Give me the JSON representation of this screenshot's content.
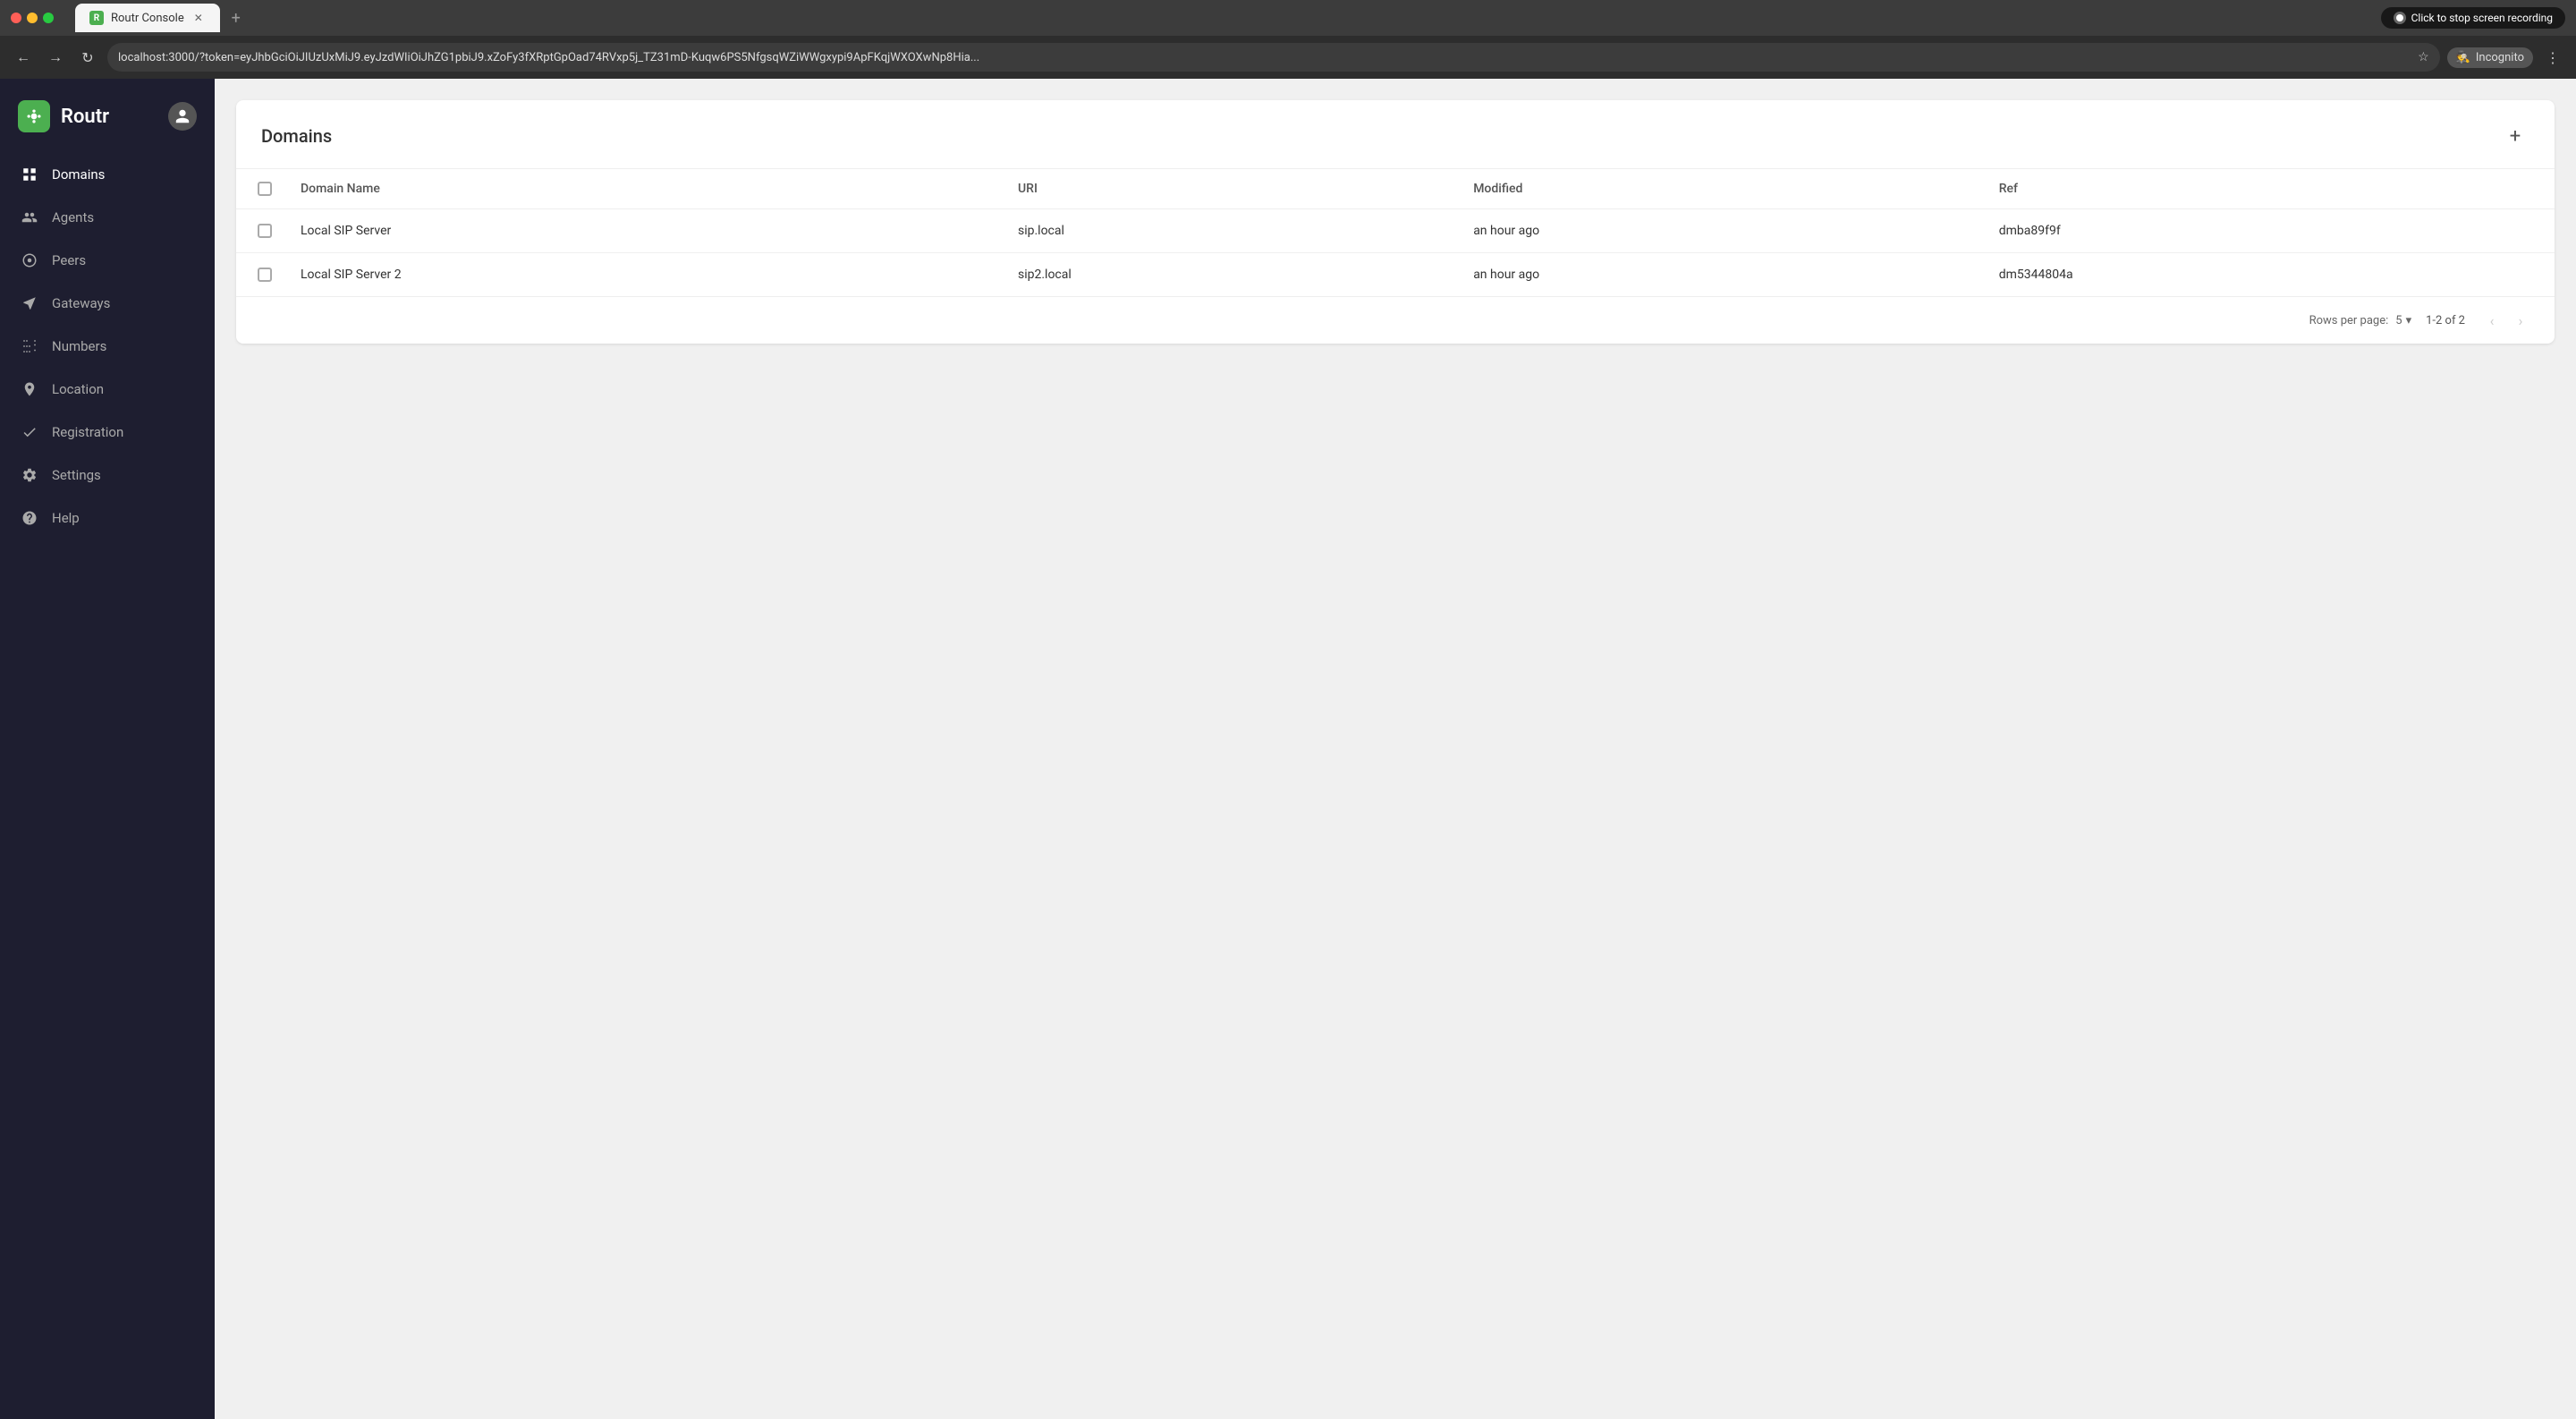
{
  "browser": {
    "tab_title": "Routr Console",
    "url": "localhost:3000/?token=eyJhbGciOiJIUzUxMiJ9.eyJzdWIiOiJhZG1pbiJ9.xZoFy3fXRptGpOad74RVxp5j_TZ31mD-Kuqw6PS5NfgsqWZiWWgxypi9ApFKqjWXOXwNp8Hia...",
    "recording_text": "Click  to stop screen recording",
    "incognito_label": "Incognito"
  },
  "app": {
    "logo_text": "Routr",
    "user_icon": "👤"
  },
  "sidebar": {
    "items": [
      {
        "id": "domains",
        "label": "Domains",
        "icon": "⊞",
        "active": true
      },
      {
        "id": "agents",
        "label": "Agents",
        "icon": "👥",
        "active": false
      },
      {
        "id": "peers",
        "label": "Peers",
        "icon": "⊕",
        "active": false
      },
      {
        "id": "gateways",
        "label": "Gateways",
        "icon": "↗",
        "active": false
      },
      {
        "id": "numbers",
        "label": "Numbers",
        "icon": "⊞",
        "active": false
      },
      {
        "id": "location",
        "label": "Location",
        "icon": "◎",
        "active": false
      },
      {
        "id": "registration",
        "label": "Registration",
        "icon": "✓",
        "active": false
      },
      {
        "id": "settings",
        "label": "Settings",
        "icon": "⚙",
        "active": false
      },
      {
        "id": "help",
        "label": "Help",
        "icon": "?",
        "active": false
      }
    ]
  },
  "domains": {
    "page_title": "Domains",
    "add_button": "+",
    "columns": {
      "select": "",
      "domain_name": "Domain Name",
      "uri": "URI",
      "modified": "Modified",
      "ref": "Ref"
    },
    "rows": [
      {
        "domain_name": "Local SIP Server",
        "uri": "sip.local",
        "modified": "an hour ago",
        "ref": "dmba89f9f"
      },
      {
        "domain_name": "Local SIP Server 2",
        "uri": "sip2.local",
        "modified": "an hour ago",
        "ref": "dm5344804a"
      }
    ],
    "pagination": {
      "rows_per_page_label": "Rows per page:",
      "rows_per_page_value": "5",
      "page_info": "1-2 of 2"
    }
  }
}
